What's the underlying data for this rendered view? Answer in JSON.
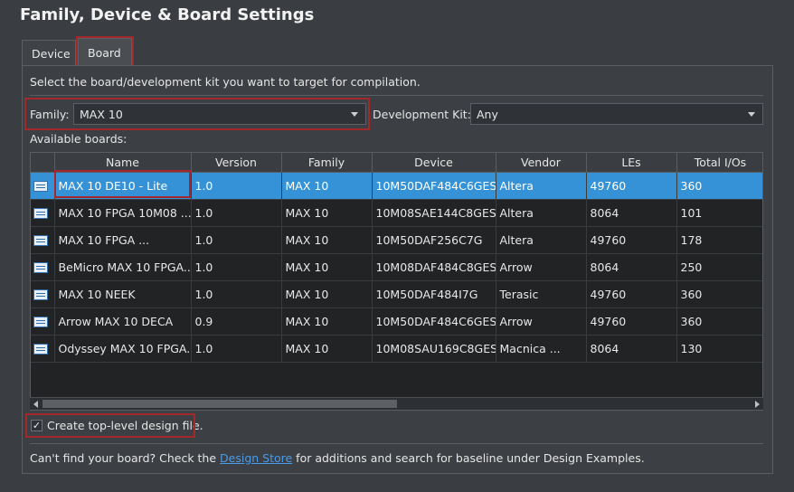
{
  "title": "Family, Device & Board Settings",
  "tabs": [
    {
      "label": "Device"
    },
    {
      "label": "Board"
    }
  ],
  "instruction": "Select the board/development kit you want to target for compilation.",
  "family": {
    "label": "Family:",
    "value": "MAX 10"
  },
  "devkit": {
    "label": "Development Kit:",
    "value": "Any"
  },
  "available_label": "Available boards:",
  "columns": [
    "",
    "Name",
    "Version",
    "Family",
    "Device",
    "Vendor",
    "LEs",
    "Total I/Os"
  ],
  "rows": [
    {
      "icon": "board-icon",
      "name": "MAX 10 DE10 - Lite",
      "version": "1.0",
      "family": "MAX 10",
      "device": "10M50DAF484C6GES",
      "vendor": "Altera",
      "les": "49760",
      "ios": "360",
      "selected": true
    },
    {
      "icon": "board-icon",
      "name": "MAX 10 FPGA 10M08 ...",
      "version": "1.0",
      "family": "MAX 10",
      "device": "10M08SAE144C8GES",
      "vendor": "Altera",
      "les": "8064",
      "ios": "101"
    },
    {
      "icon": "board-icon",
      "name": "MAX 10 FPGA ...",
      "version": "1.0",
      "family": "MAX 10",
      "device": "10M50DAF256C7G",
      "vendor": "Altera",
      "les": "49760",
      "ios": "178"
    },
    {
      "icon": "board-icon",
      "name": "BeMicro MAX 10 FPGA...",
      "version": "1.0",
      "family": "MAX 10",
      "device": "10M08DAF484C8GES",
      "vendor": "Arrow",
      "les": "8064",
      "ios": "250"
    },
    {
      "icon": "board-icon",
      "name": "MAX 10 NEEK",
      "version": "1.0",
      "family": "MAX 10",
      "device": "10M50DAF484I7G",
      "vendor": "Terasic",
      "les": "49760",
      "ios": "360"
    },
    {
      "icon": "board-icon",
      "name": "Arrow MAX 10 DECA",
      "version": "0.9",
      "family": "MAX 10",
      "device": "10M50DAF484C6GES",
      "vendor": "Arrow",
      "les": "49760",
      "ios": "360"
    },
    {
      "icon": "board-icon",
      "name": "Odyssey MAX 10 FPGA...",
      "version": "1.0",
      "family": "MAX 10",
      "device": "10M08SAU169C8GES",
      "vendor": "Macnica ...",
      "les": "8064",
      "ios": "130"
    }
  ],
  "checkbox": {
    "label": "Create top-level design file.",
    "checked": true,
    "mark": "✓"
  },
  "footer": {
    "before": "Can't find your board? Check the ",
    "link": "Design Store",
    "after": " for additions and search for baseline under Design Examples."
  },
  "colors": {
    "selection": "#3592d6",
    "highlight": "#a3282c",
    "link": "#4c9be8"
  }
}
